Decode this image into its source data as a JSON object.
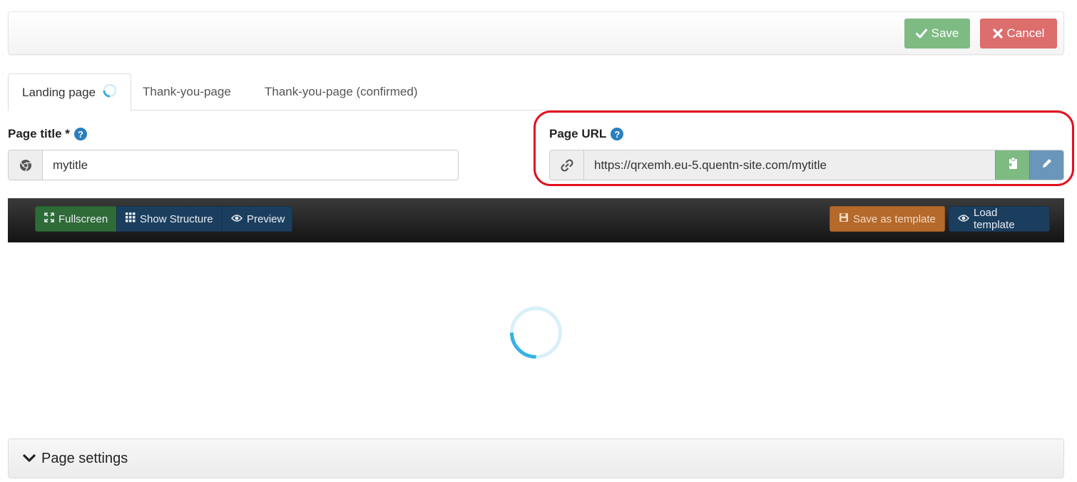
{
  "header": {
    "save_label": "Save",
    "cancel_label": "Cancel",
    "save_color": "#7dbb83",
    "cancel_color": "#dd6e6e"
  },
  "tabs": [
    {
      "label": "Landing page",
      "active": true,
      "loading": true
    },
    {
      "label": "Thank-you-page",
      "active": false
    },
    {
      "label": "Thank-you-page (confirmed)",
      "active": false
    }
  ],
  "page_title": {
    "label": "Page title *",
    "help_icon": "question-circle-icon",
    "addon_icon": "chrome-icon",
    "value": "mytitle"
  },
  "page_url": {
    "label": "Page URL",
    "help_icon": "question-circle-icon",
    "addon_icon": "link-icon",
    "value": "https://qrxemh.eu-5.quentn-site.com/mytitle",
    "copy_icon": "clipboard-icon",
    "edit_icon": "pencil-icon",
    "highlight_color": "#e3101e"
  },
  "editor_toolbar": {
    "fullscreen_label": "Fullscreen",
    "show_structure_label": "Show Structure",
    "preview_label": "Preview",
    "save_template_label": "Save as template",
    "load_template_label": "Load template"
  },
  "settings": {
    "label": "Page settings",
    "icon": "chevron-down-icon"
  }
}
